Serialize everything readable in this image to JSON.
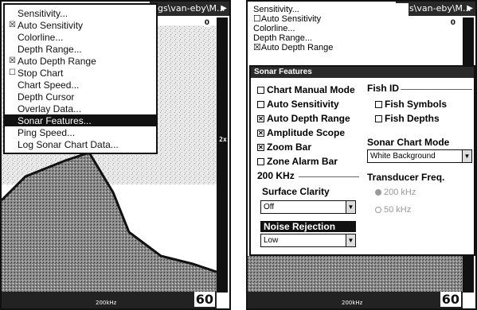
{
  "left": {
    "title": "ngs\\van-eby\\M...",
    "menu": [
      {
        "label": "Sensitivity...",
        "mark": ""
      },
      {
        "label": "Auto Sensitivity",
        "mark": "☒"
      },
      {
        "label": "Colorline...",
        "mark": ""
      },
      {
        "label": "Depth Range...",
        "mark": ""
      },
      {
        "label": "Auto Depth Range",
        "mark": "☒"
      },
      {
        "label": "Stop Chart",
        "mark": "☐"
      },
      {
        "label": "Chart Speed...",
        "mark": ""
      },
      {
        "label": "Depth Cursor",
        "mark": ""
      },
      {
        "label": "Overlay Data...",
        "mark": ""
      },
      {
        "label": "Sonar Features...",
        "mark": "",
        "selected": true
      },
      {
        "label": "Ping Speed...",
        "mark": ""
      },
      {
        "label": "Log Sonar Chart Data...",
        "mark": ""
      }
    ],
    "depth_top": "0",
    "depth_bottom": "60",
    "freq": "200kHz",
    "zoom": "2x"
  },
  "right": {
    "title": "ngs\\van-eby\\M...",
    "mini_menu": [
      "Sensitivity...",
      "Auto Sensitivity",
      "Colorline...",
      "Depth Range...",
      "Auto Depth Range"
    ],
    "mini_marks": [
      "",
      "☐",
      "",
      "",
      "☒"
    ],
    "dialog_title": "Sonar Features",
    "checkboxes": [
      {
        "label": "Chart Manual Mode",
        "checked": false
      },
      {
        "label": "Auto Sensitivity",
        "checked": false
      },
      {
        "label": "Auto Depth Range",
        "checked": true
      },
      {
        "label": "Amplitude Scope",
        "checked": true
      },
      {
        "label": "Zoom Bar",
        "checked": true
      },
      {
        "label": "Zone Alarm Bar",
        "checked": false
      }
    ],
    "fish_id": {
      "header": "Fish ID",
      "symbols": "Fish Symbols",
      "depths": "Fish Depths"
    },
    "chart_mode": {
      "header": "Sonar Chart Mode",
      "value": "White Background"
    },
    "khz_header": "200 KHz",
    "surface_clarity": {
      "label": "Surface Clarity",
      "value": "Off"
    },
    "noise_rejection": {
      "label": "Noise Rejection",
      "value": "Low"
    },
    "transducer": {
      "header": "Transducer Freq.",
      "opt1": "200 kHz",
      "opt2": "50 kHz"
    },
    "depth_top": "0",
    "depth_bottom": "60",
    "freq": "200kHz"
  }
}
